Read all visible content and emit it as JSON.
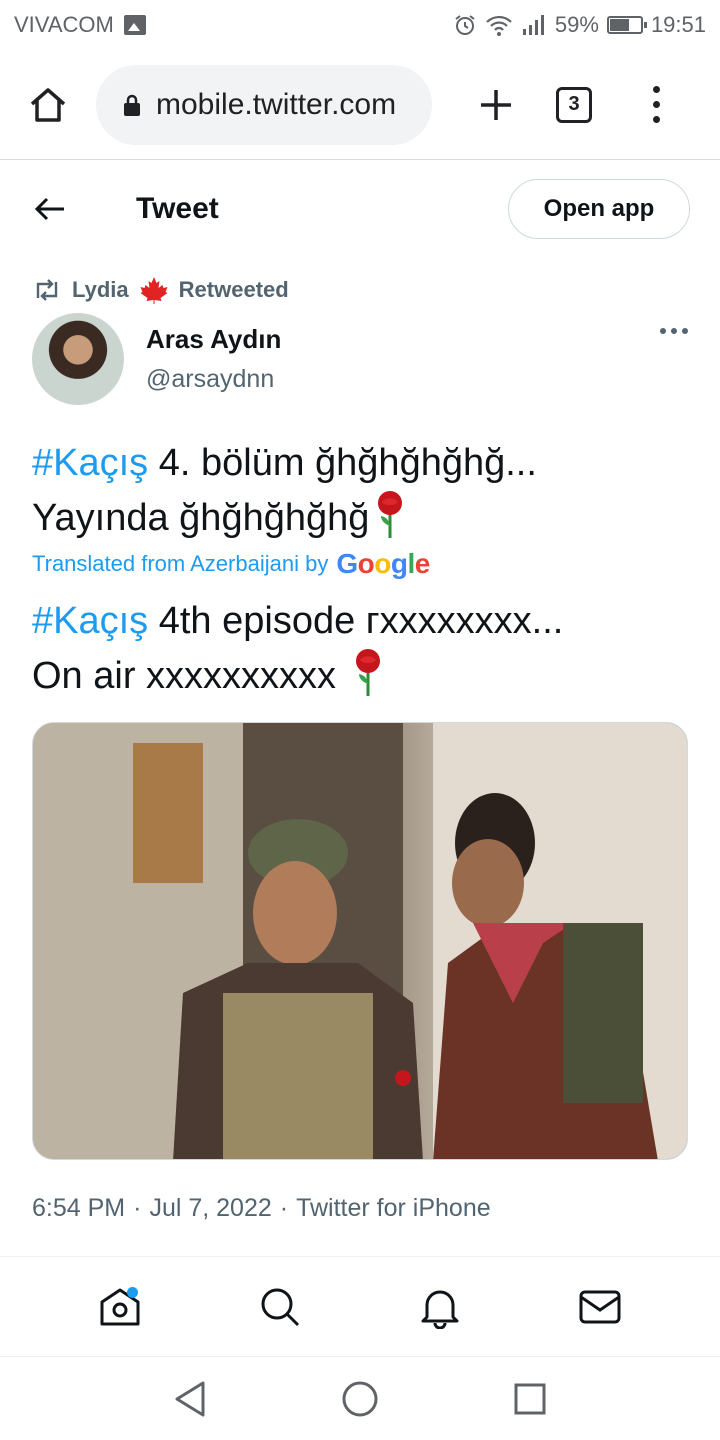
{
  "status_bar": {
    "carrier": "VIVACOM",
    "battery": "59%",
    "battery_level": 0.59,
    "time": "19:51"
  },
  "browser": {
    "url": "mobile.twitter.com",
    "tab_count": "3"
  },
  "header": {
    "title": "Tweet",
    "open_app_label": "Open app"
  },
  "retweet": {
    "user": "Lydia",
    "label": "Retweeted"
  },
  "author": {
    "display_name": "Aras Aydın",
    "handle": "@arsaydnn"
  },
  "tweet": {
    "hashtag": "#Kaçış",
    "original_line1": " 4. bölüm ğhğhğhğhğ...",
    "original_line2": "Yayında ğhğhğhğhğ",
    "translated_from": "Translated from Azerbaijani by",
    "google": "Google",
    "translation_line1": " 4th episode гxxxxxxxx...",
    "translation_line2": "On air xxxxxxxxxx "
  },
  "meta": {
    "time": "6:54 PM",
    "date": "Jul 7, 2022",
    "source": "Twitter for iPhone",
    "separator": "·"
  },
  "colors": {
    "accent": "#1d9bf0",
    "secondary_text": "#536471",
    "primary_text": "#0f1419"
  }
}
